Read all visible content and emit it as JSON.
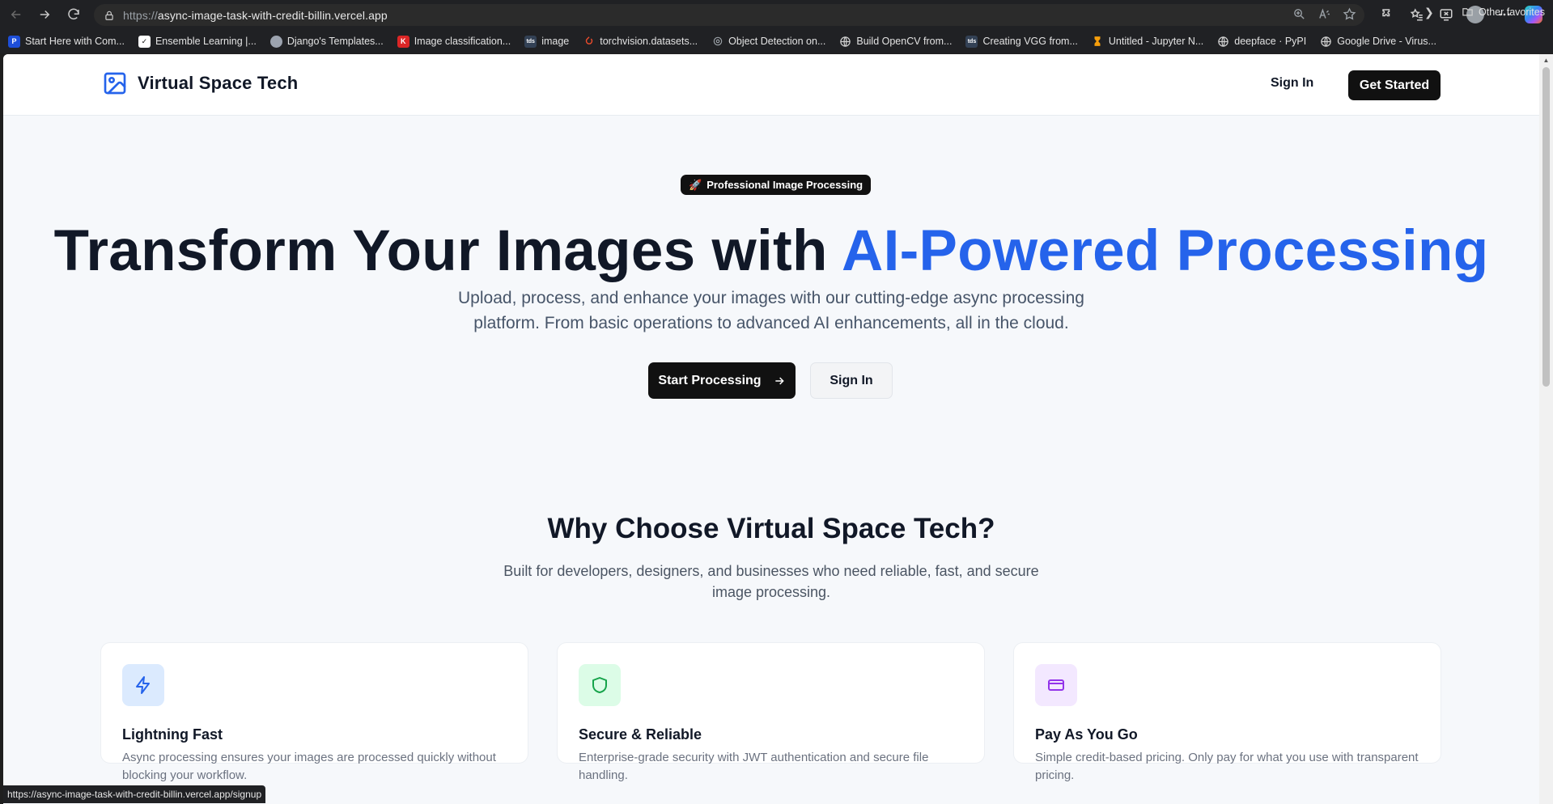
{
  "browser": {
    "url_scheme": "https://",
    "url_host": "async-image-task-with-credit-billin.vercel.app",
    "bookmarks": [
      {
        "label": "Start Here with Com...",
        "icon": "pi-icon",
        "color": "#1d4ed8",
        "glyph": "P"
      },
      {
        "label": "Ensemble Learning |...",
        "icon": "doc-icon",
        "color": "#ffffff",
        "glyph": ""
      },
      {
        "label": "Django's Templates...",
        "icon": "avatar-icon",
        "color": "#9ca3af",
        "glyph": ""
      },
      {
        "label": "Image classification...",
        "icon": "k-icon",
        "color": "#dc2626",
        "glyph": "K"
      },
      {
        "label": "image",
        "icon": "tds-icon",
        "color": "#334155",
        "glyph": "tds"
      },
      {
        "label": "torchvision.datasets...",
        "icon": "pytorch-icon",
        "color": "#ee4c2c",
        "glyph": ""
      },
      {
        "label": "Object Detection on...",
        "icon": "eye-icon",
        "color": "#6b7280",
        "glyph": ""
      },
      {
        "label": "Build OpenCV from...",
        "icon": "globe-icon",
        "color": "#202124",
        "glyph": ""
      },
      {
        "label": "Creating VGG from...",
        "icon": "tds-icon",
        "color": "#334155",
        "glyph": "tds"
      },
      {
        "label": "Untitled - Jupyter N...",
        "icon": "hourglass-icon",
        "color": "#f59e0b",
        "glyph": ""
      },
      {
        "label": "deepface · PyPI",
        "icon": "globe-icon",
        "color": "#202124",
        "glyph": ""
      },
      {
        "label": "Google Drive - Virus...",
        "icon": "globe-icon",
        "color": "#202124",
        "glyph": ""
      }
    ],
    "other_favorites": "Other favorites",
    "status_url": "https://async-image-task-with-credit-billin.vercel.app/signup"
  },
  "header": {
    "brand": "Virtual Space Tech",
    "sign_in": "Sign In",
    "get_started": "Get Started"
  },
  "hero": {
    "badge_emoji": "🚀",
    "badge": "Professional Image Processing",
    "title_part1": "Transform Your Images with ",
    "title_accent": "AI-Powered Processing",
    "subtitle": "Upload, process, and enhance your images with our cutting-edge async processing platform. From basic operations to advanced AI enhancements, all in the cloud.",
    "start_button": "Start Processing",
    "signin_button": "Sign In"
  },
  "why": {
    "title": "Why Choose Virtual Space Tech?",
    "subtitle": "Built for developers, designers, and businesses who need reliable, fast, and secure image processing."
  },
  "features": [
    {
      "title": "Lightning Fast",
      "desc": "Async processing ensures your images are processed quickly without blocking your workflow.",
      "icon": "lightning-icon",
      "bg": "#dbeafe",
      "fg": "#2563eb"
    },
    {
      "title": "Secure & Reliable",
      "desc": "Enterprise-grade security with JWT authentication and secure file handling.",
      "icon": "shield-icon",
      "bg": "#dcfce7",
      "fg": "#16a34a"
    },
    {
      "title": "Pay As You Go",
      "desc": "Simple credit-based pricing. Only pay for what you use with transparent pricing.",
      "icon": "credit-card-icon",
      "bg": "#f3e8ff",
      "fg": "#9333ea"
    }
  ]
}
